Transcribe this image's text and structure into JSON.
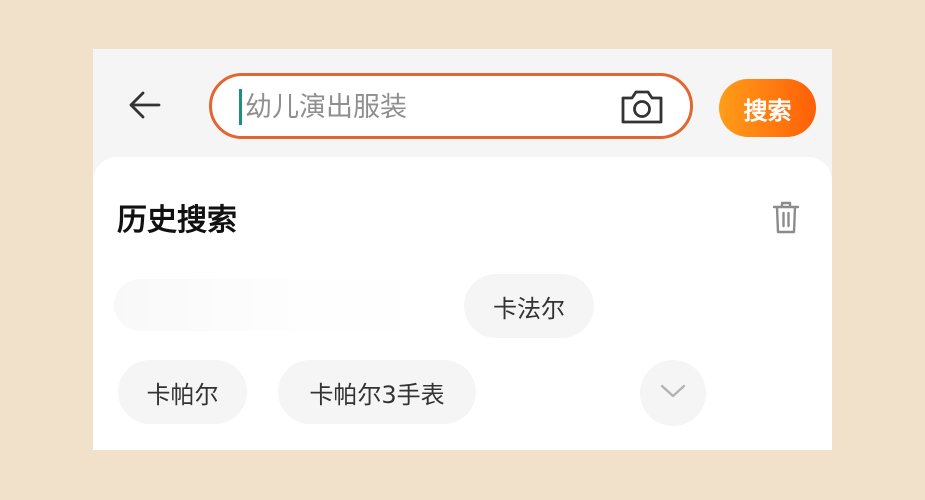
{
  "header": {
    "back_icon": "arrow-left-icon"
  },
  "search": {
    "placeholder": "幼儿演出服装",
    "value": "",
    "camera_icon": "camera-icon",
    "button_label": "搜索",
    "accent_color": "#E3652F",
    "button_gradient": [
      "#FF9D19",
      "#FF5F07"
    ]
  },
  "history": {
    "title": "历史搜索",
    "clear_icon": "trash-icon",
    "chips": [
      {
        "label": "卡法尔"
      },
      {
        "label": "卡帕尔"
      },
      {
        "label": "卡帕尔3手表"
      }
    ],
    "expand_icon": "chevron-down-icon"
  }
}
